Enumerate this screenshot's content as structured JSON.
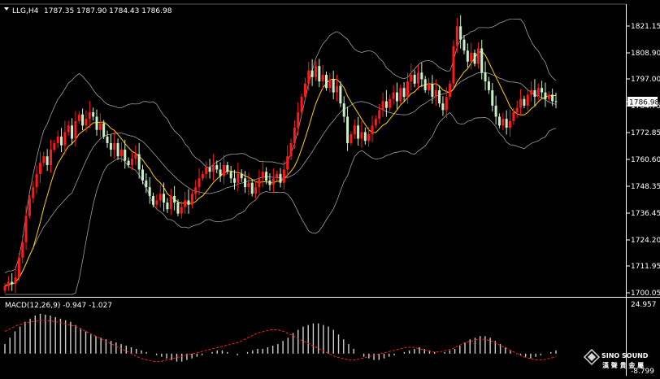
{
  "header": {
    "symbol": "LLG,H4",
    "ohlc": "1787.35 1787.90 1784.43 1786.98"
  },
  "price_axis": {
    "ticks": [
      "1821.15",
      "1808.90",
      "1797.00",
      "1784.75",
      "1772.85",
      "1760.60",
      "1748.35",
      "1736.45",
      "1724.20",
      "1711.95",
      "1700.05"
    ],
    "current_price": "1786.98"
  },
  "macd_panel": {
    "label": "MACD(12,26,9) -0.947 -1.027",
    "top_value": "24.957",
    "bottom_value": "-8.799"
  },
  "logo": {
    "text": "SINO SOUND",
    "sub": "漢 聲 貴 金 屬"
  },
  "colors": {
    "background": "#000000",
    "bull_candle": "#ff1a1a",
    "bear_candle": "#c8f0c8",
    "ma": "#ffd200",
    "bands": "#a0a0a0",
    "signal": "#ff2020",
    "histogram": "#d0d0d0"
  },
  "chart_data": {
    "type": "candlestick",
    "interval": "H4",
    "ylim": [
      1700.05,
      1826
    ],
    "close": [
      1703,
      1705,
      1704,
      1707,
      1716,
      1723,
      1735,
      1743,
      1748,
      1754,
      1759,
      1762,
      1758,
      1765,
      1768,
      1771,
      1767,
      1773,
      1776,
      1770,
      1778,
      1781,
      1776,
      1779,
      1782,
      1780,
      1774,
      1777,
      1771,
      1768,
      1765,
      1768,
      1762,
      1765,
      1760,
      1758,
      1761,
      1763,
      1756,
      1751,
      1748,
      1744,
      1740,
      1742,
      1745,
      1741,
      1738,
      1744,
      1741,
      1736,
      1739,
      1742,
      1740,
      1745,
      1748,
      1752,
      1754,
      1757,
      1755,
      1758,
      1756,
      1753,
      1758,
      1755,
      1752,
      1750,
      1754,
      1752,
      1748,
      1750,
      1745,
      1748,
      1752,
      1755,
      1751,
      1749,
      1752,
      1754,
      1750,
      1756,
      1762,
      1768,
      1775,
      1782,
      1789,
      1795,
      1801,
      1798,
      1803,
      1796,
      1799,
      1793,
      1797,
      1791,
      1794,
      1786,
      1780,
      1768,
      1772,
      1776,
      1770,
      1773,
      1769,
      1772,
      1776,
      1779,
      1783,
      1787,
      1784,
      1788,
      1791,
      1787,
      1793,
      1789,
      1796,
      1799,
      1795,
      1800,
      1797,
      1792,
      1795,
      1789,
      1792,
      1786,
      1783,
      1789,
      1795,
      1812,
      1821,
      1815,
      1810,
      1805,
      1809,
      1804,
      1811,
      1800,
      1796,
      1792,
      1785,
      1780,
      1776,
      1779,
      1775,
      1778,
      1782,
      1784,
      1788,
      1785,
      1790,
      1792,
      1789,
      1793,
      1791,
      1788,
      1790,
      1787,
      1786.98
    ],
    "macd_histogram": [
      6,
      10,
      14,
      17,
      20,
      22,
      24,
      25,
      24.5,
      24,
      23,
      22,
      21,
      20,
      18,
      16,
      14,
      12,
      11,
      10,
      9,
      8,
      7,
      6,
      5,
      4,
      3,
      2,
      1,
      0,
      -1,
      -2,
      -3,
      -4,
      -5,
      -5,
      -4,
      -3,
      -2,
      -1,
      0,
      1,
      2,
      2,
      1,
      0,
      -1,
      0,
      1,
      2,
      3,
      3,
      4,
      5,
      6,
      8,
      10,
      13,
      15,
      17,
      18,
      19,
      19,
      18,
      17,
      15,
      12,
      9,
      6,
      3,
      0,
      -2,
      -3,
      -4,
      -4,
      -3,
      -2,
      -1,
      0,
      1,
      2,
      3,
      4,
      3,
      2,
      1,
      0,
      1,
      2,
      3,
      5,
      7,
      9,
      10,
      11,
      11,
      10,
      8,
      6,
      4,
      2,
      0,
      -1,
      -2,
      -3,
      -2,
      -1,
      0,
      1,
      2
    ],
    "macd_signal": [
      14,
      16,
      18,
      19,
      20,
      20.5,
      21,
      20.5,
      20,
      19,
      18,
      17,
      15,
      13,
      11,
      9,
      7,
      5,
      3,
      1,
      -1,
      -3,
      -4,
      -5,
      -5,
      -4,
      -3,
      -2,
      -1,
      0,
      1,
      2,
      3,
      4,
      5,
      6,
      7,
      9,
      11,
      13,
      14,
      15,
      15,
      14,
      12,
      10,
      8,
      6,
      4,
      2,
      0,
      -2,
      -3,
      -4,
      -4,
      -3,
      -2,
      -1,
      0,
      1,
      2,
      3,
      4,
      4,
      3,
      2,
      1,
      1,
      2,
      3,
      5,
      7,
      8,
      9,
      9,
      8,
      6,
      4,
      2,
      0,
      -2,
      -3,
      -4,
      -4,
      -3,
      -2
    ]
  }
}
